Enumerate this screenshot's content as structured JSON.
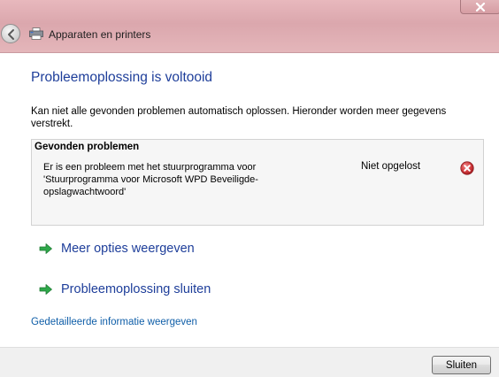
{
  "header": {
    "breadcrumb": "Apparaten en printers"
  },
  "main": {
    "heading": "Probleemoplossing is voltooid",
    "description": "Kan niet alle gevonden problemen automatisch oplossen. Hieronder worden meer gegevens verstrekt.",
    "problems": {
      "header": "Gevonden problemen",
      "items": [
        {
          "text": "Er is een probleem met het stuurprogramma voor 'Stuurprogramma voor Microsoft WPD Beveiligde-opslagwachtwoord'",
          "status": "Niet opgelost",
          "icon": "error-icon"
        }
      ]
    },
    "commands": [
      {
        "label": "Meer opties weergeven",
        "icon": "green-arrow-icon"
      },
      {
        "label": "Probleemoplossing sluiten",
        "icon": "green-arrow-icon"
      }
    ],
    "details_link": "Gedetailleerde informatie weergeven"
  },
  "footer": {
    "close_label": "Sluiten"
  },
  "colors": {
    "titlebar": "#e0b0b5",
    "heading": "#1e3e9a",
    "link": "#0f5ea8",
    "arrow": "#2ea84a",
    "error": "#c9262b"
  }
}
